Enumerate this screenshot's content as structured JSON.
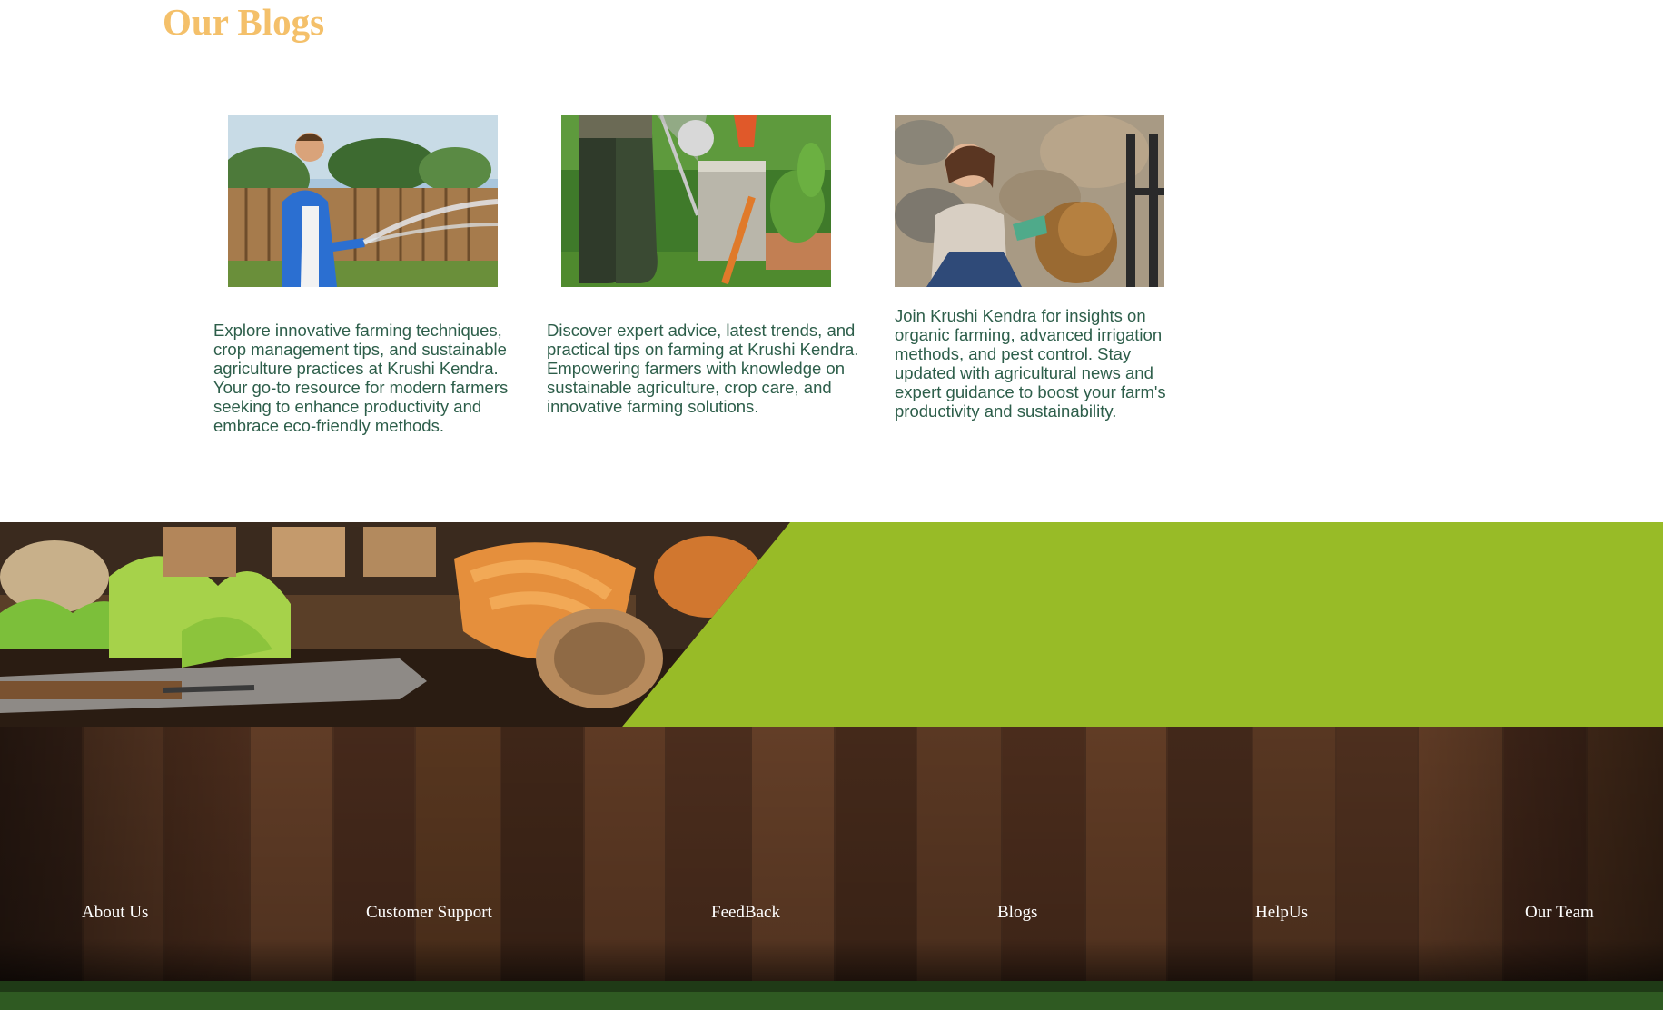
{
  "section": {
    "title": "Our Blogs"
  },
  "blogs": [
    {
      "image_icon": "man-watering-garden-photo",
      "text": "Explore innovative farming techniques, crop management tips, and sustainable agriculture practices at Krushi Kendra. Your go-to resource for modern farmers seeking to enhance productivity and embrace eco-friendly methods."
    },
    {
      "image_icon": "garden-boots-tools-photo",
      "text": "Discover expert advice, latest trends, and practical tips on farming at Krushi Kendra. Empowering farmers with knowledge on sustainable agriculture, crop care, and innovative farming solutions."
    },
    {
      "image_icon": "woman-gardening-leaves-photo",
      "text": "Join Krushi Kendra for insights on organic farming, advanced irrigation methods, and pest control. Stay updated with agricultural news and expert guidance to boost your farm's productivity and sustainability."
    }
  ],
  "banner": {
    "image_icon": "garden-tools-seedlings-photo",
    "accent_color": "#98bb27"
  },
  "footer": {
    "links": [
      "About Us",
      "Customer Support",
      "FeedBack",
      "Blogs",
      "HelpUs",
      "Our Team"
    ]
  },
  "colors": {
    "title": "#f4c06a",
    "body_text": "#2d5e4a",
    "banner_green": "#98bb27",
    "footer_wood": "#3a2418"
  }
}
